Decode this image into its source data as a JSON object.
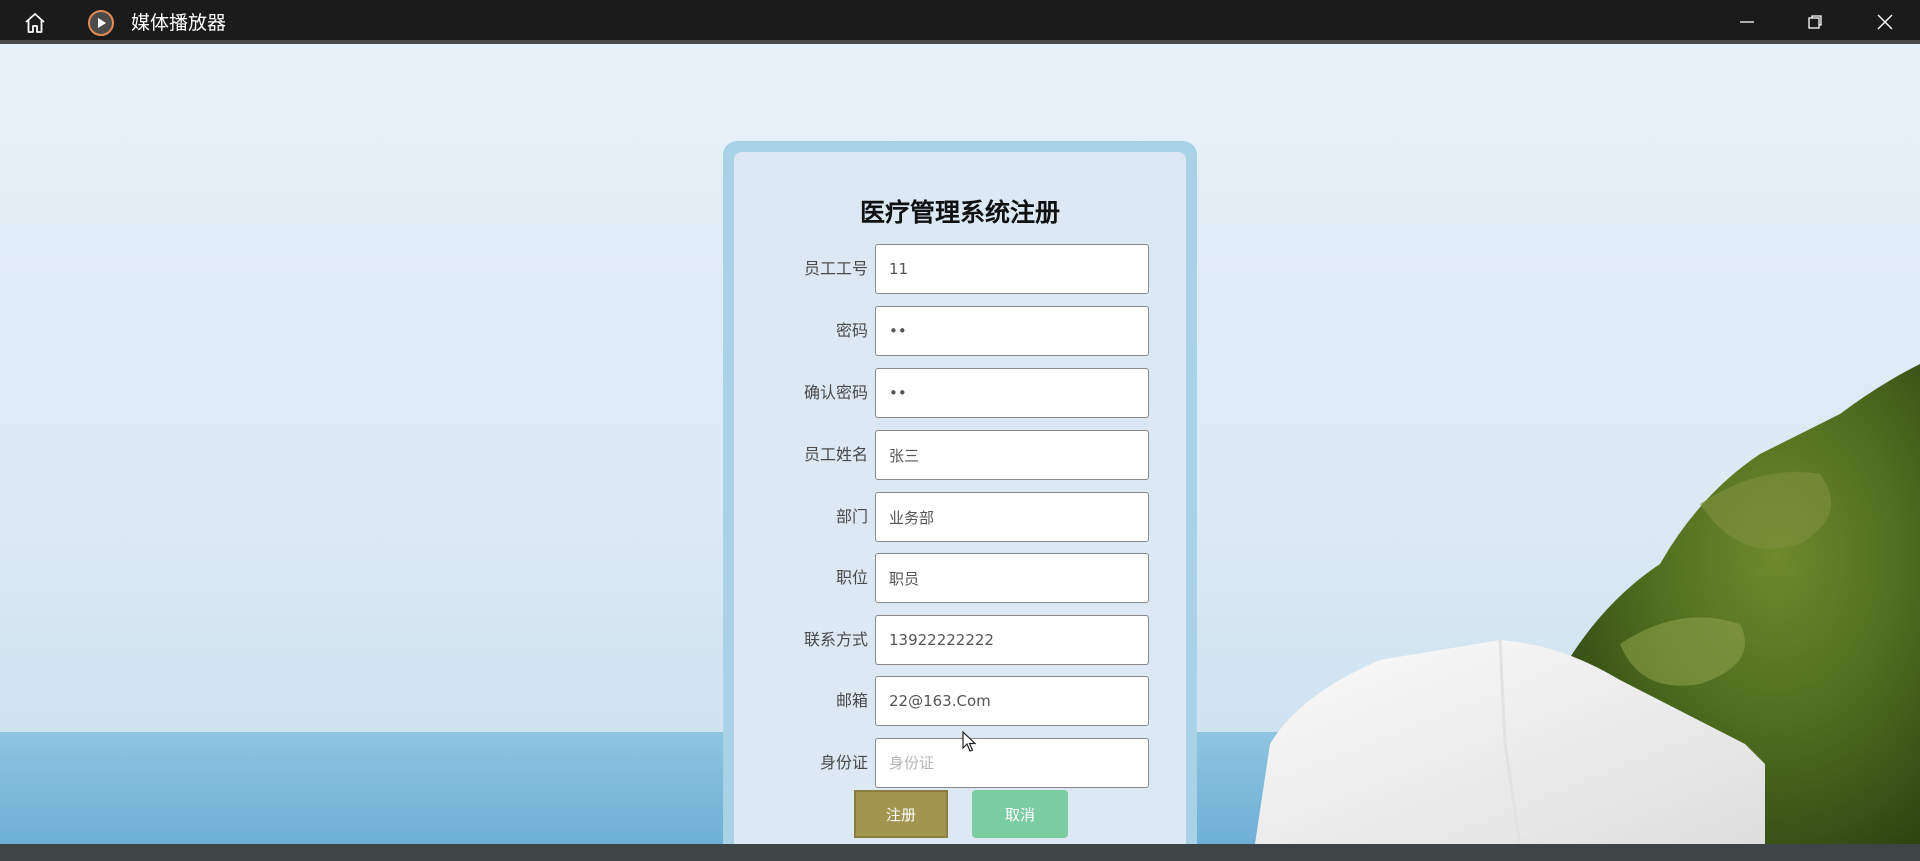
{
  "window": {
    "title": "媒体播放器",
    "icons": {
      "home": "home-icon",
      "app": "media-player-icon",
      "minimize": "minimize-icon",
      "maximize": "restore-icon",
      "close": "close-icon"
    }
  },
  "form": {
    "title": "医疗管理系统注册",
    "fields": [
      {
        "label": "员工工号",
        "value": "11",
        "placeholder": ""
      },
      {
        "label": "密码",
        "value": "••",
        "placeholder": ""
      },
      {
        "label": "确认密码",
        "value": "••",
        "placeholder": ""
      },
      {
        "label": "员工姓名",
        "value": "张三",
        "placeholder": ""
      },
      {
        "label": "部门",
        "value": "业务部",
        "placeholder": ""
      },
      {
        "label": "职位",
        "value": "职员",
        "placeholder": ""
      },
      {
        "label": "联系方式",
        "value": "13922222222",
        "placeholder": ""
      },
      {
        "label": "邮箱",
        "value": "22@163.Com",
        "placeholder": ""
      },
      {
        "label": "身份证",
        "value": "",
        "placeholder": "身份证"
      }
    ],
    "register_label": "注册",
    "cancel_label": "取消"
  },
  "colors": {
    "titlebar": "#1b1b1b",
    "card_border": "#a9d2e6",
    "card_bg": "#dce8f3",
    "register_button": "#a29550",
    "cancel_button": "#7bcca0"
  }
}
